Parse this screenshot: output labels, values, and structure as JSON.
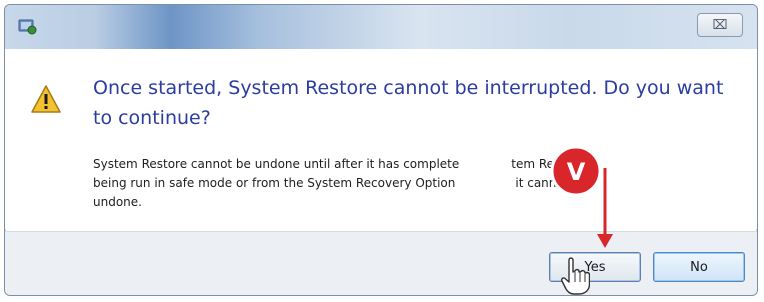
{
  "window": {
    "close_glyph": "⌧",
    "icon": "system-restore-icon"
  },
  "dialog": {
    "main_instruction": "Once started, System Restore cannot be interrupted. Do you want to continue?",
    "content": "System Restore cannot be undone until after it has complete",
    "content_tail_1": "tem Restore is",
    "content_line_2": "being run in safe mode or from the System Recovery Option",
    "content_tail_2": "it cannot be",
    "content_line_3": "undone.",
    "warning_icon": "warning-icon"
  },
  "buttons": {
    "yes_label": "Yes",
    "no_label": "No"
  },
  "annotation": {
    "marker_letter": "V",
    "marker_color": "#d8262a",
    "arrow_color": "#d8262a"
  },
  "colors": {
    "instruction_text": "#2b3d9e",
    "footer_bg": "#eceff3"
  }
}
